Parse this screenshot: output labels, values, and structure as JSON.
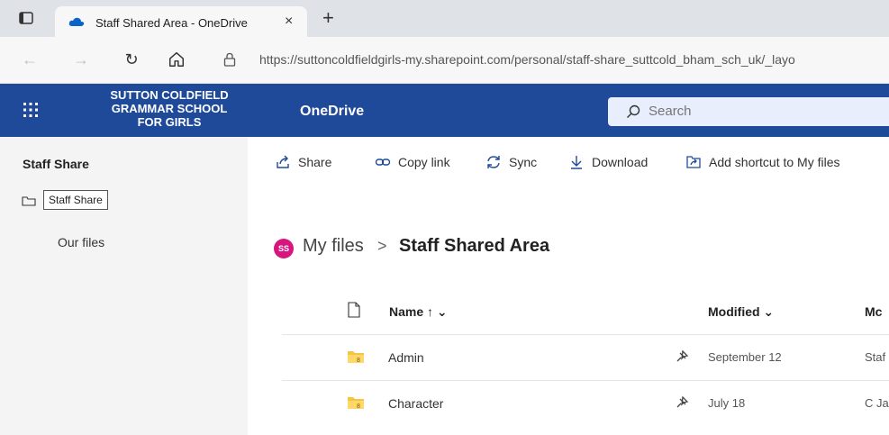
{
  "browser": {
    "tab_title": "Staff Shared Area - OneDrive",
    "tab_close": "×",
    "new_tab": "+",
    "url": "https://suttoncoldfieldgirls-my.sharepoint.com/personal/staff-share_suttcold_bham_sch_uk/_layo"
  },
  "header": {
    "school_line1": "SUTTON COLDFIELD",
    "school_line2": "GRAMMAR SCHOOL",
    "school_line3": "FOR GIRLS",
    "brand": "OneDrive",
    "search_placeholder": "Search",
    "color": "#1f4a9a"
  },
  "sidebar": {
    "title": "Staff Share",
    "tooltip": "Staff Share",
    "items": [
      {
        "label": "Our files"
      }
    ]
  },
  "commands": [
    {
      "label": "Share",
      "icon": "share-icon"
    },
    {
      "label": "Copy link",
      "icon": "link-icon"
    },
    {
      "label": "Sync",
      "icon": "sync-icon"
    },
    {
      "label": "Download",
      "icon": "download-icon"
    },
    {
      "label": "Add shortcut to My files",
      "icon": "shortcut-icon"
    }
  ],
  "breadcrumb": {
    "avatar": "SS",
    "root": "My files",
    "separator": ">",
    "current": "Staff Shared Area"
  },
  "table": {
    "columns": {
      "name": "Name ↑ ⌄",
      "modified": "Modified ⌄",
      "modified_by": "Mc"
    },
    "rows": [
      {
        "name": "Admin",
        "modified": "September 12",
        "modified_by": "Staf"
      },
      {
        "name": "Character",
        "modified": "July 18",
        "modified_by": "C Ja"
      }
    ]
  }
}
